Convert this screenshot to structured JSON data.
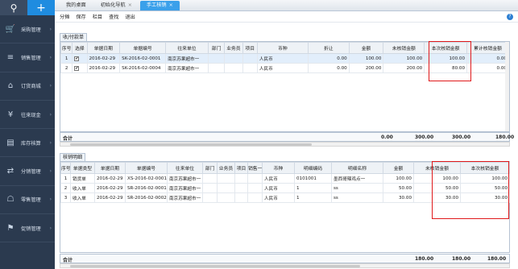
{
  "sidebar": {
    "top_search_icon": "search-icon",
    "top_add_icon": "plus-icon",
    "items": [
      {
        "label": "采购管理",
        "icon": "cart-icon"
      },
      {
        "label": "销售管理",
        "icon": "chart-icon"
      },
      {
        "label": "订货商城",
        "icon": "store-icon"
      },
      {
        "label": "往来现金",
        "icon": "money-icon"
      },
      {
        "label": "库存核算",
        "icon": "inventory-icon"
      },
      {
        "label": "分销管理",
        "icon": "distribution-icon"
      },
      {
        "label": "零售管理",
        "icon": "retail-icon"
      },
      {
        "label": "促销管理",
        "icon": "promo-icon"
      }
    ]
  },
  "tabs": [
    {
      "label": "我的桌面",
      "closable": false
    },
    {
      "label": "初始化导航",
      "closable": true
    },
    {
      "label": "手工核销",
      "closable": true,
      "active": true
    }
  ],
  "toolbar": [
    "分摊",
    "保存",
    "栏目",
    "查找",
    "退出"
  ],
  "section1": {
    "tab_label": "收/付款单",
    "headers": [
      "序号",
      "选择",
      "单据日期",
      "单据编号",
      "往来单位",
      "部门",
      "业务员",
      "项目",
      "币种",
      "折让",
      "金额",
      "未核销金额",
      "本次核销金额",
      "累计核销金额"
    ],
    "rows": [
      [
        "1",
        "✔",
        "2016-02-29",
        "SK-2016-02-0001",
        "南京苏果超市一",
        "",
        "",
        "",
        "人民币",
        "0.00",
        "100.00",
        "100.00",
        "100.00",
        "0.00"
      ],
      [
        "2",
        "✔",
        "2016-02-29",
        "SK-2016-02-0004",
        "南京苏果超市一",
        "",
        "",
        "",
        "人民币",
        "0.00",
        "200.00",
        "200.00",
        "80.00",
        "0.00"
      ]
    ],
    "sum": {
      "label": "合计",
      "discount": "0.00",
      "amount": "300.00",
      "unverified": "300.00",
      "this_time": "180.00",
      "accum": "0.00"
    }
  },
  "section2": {
    "tab_label": "核销明细",
    "headers": [
      "序号",
      "单据类型",
      "单据日期",
      "单据编号",
      "往来单位",
      "部门",
      "业务员",
      "项目",
      "销售一",
      "币种",
      "明细编码",
      "明细名称",
      "金额",
      "未核销金额",
      "本次核销金额"
    ],
    "rows": [
      [
        "1",
        "销货单",
        "2016-02-29",
        "XS-2016-02-0001",
        "南京苏果超市一",
        "",
        "",
        "",
        "",
        "人民币",
        "0101001",
        "墨西哥辣鸡点一",
        "100.00",
        "100.00",
        "100.00"
      ],
      [
        "2",
        "收入单",
        "2016-02-29",
        "SR-2016-02-0001",
        "南京苏果超市一",
        "",
        "",
        "",
        "",
        "人民币",
        "1",
        "ss",
        "50.00",
        "50.00",
        "50.00"
      ],
      [
        "3",
        "收入单",
        "2016-02-29",
        "SR-2016-02-0002",
        "南京苏果超市一",
        "",
        "",
        "",
        "",
        "人民币",
        "1",
        "ss",
        "30.00",
        "30.00",
        "30.00"
      ]
    ],
    "sum": {
      "label": "合计",
      "amount": "180.00",
      "unverified": "180.00",
      "this_time": "180.00"
    }
  }
}
